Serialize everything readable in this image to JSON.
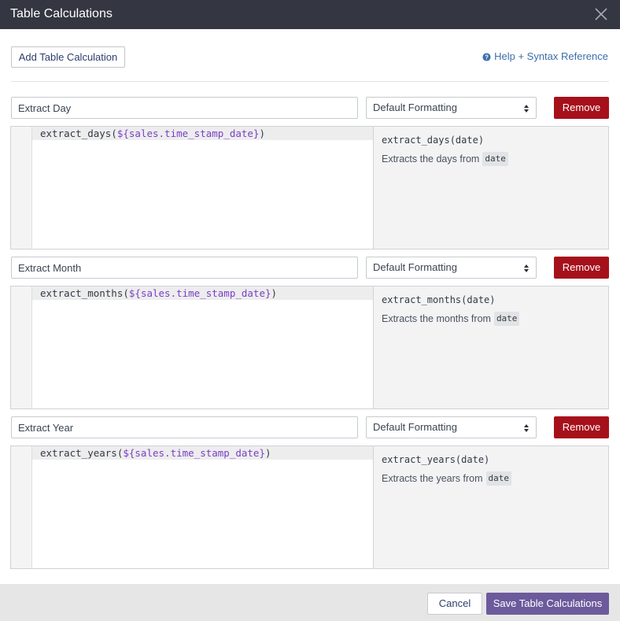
{
  "window": {
    "title": "Table Calculations",
    "close_icon": "close-icon"
  },
  "toolbar": {
    "add_label": "Add Table Calculation",
    "help_label": "Help + Syntax Reference",
    "help_icon": "question-circle-icon"
  },
  "calculations": [
    {
      "name": "Extract Day",
      "format": "Default Formatting",
      "remove_label": "Remove",
      "code_fn": "extract_days(",
      "code_field": "${sales.time_stamp_date}",
      "code_close": ")",
      "doc_signature": "extract_days(date)",
      "doc_text": "Extracts the days from",
      "doc_param": "date"
    },
    {
      "name": "Extract Month",
      "format": "Default Formatting",
      "remove_label": "Remove",
      "code_fn": "extract_months(",
      "code_field": "${sales.time_stamp_date}",
      "code_close": ")",
      "doc_signature": "extract_months(date)",
      "doc_text": "Extracts the months from",
      "doc_param": "date"
    },
    {
      "name": "Extract Year",
      "format": "Default Formatting",
      "remove_label": "Remove",
      "code_fn": "extract_years(",
      "code_field": "${sales.time_stamp_date}",
      "code_close": ")",
      "doc_signature": "extract_years(date)",
      "doc_text": "Extracts the years from",
      "doc_param": "date"
    }
  ],
  "footer": {
    "cancel_label": "Cancel",
    "save_label": "Save Table Calculations"
  },
  "colors": {
    "titlebar": "#343741",
    "remove": "#a6101b",
    "save": "#6c5a9c",
    "field_token": "#7b3fc4",
    "link": "#3c6fa8"
  }
}
